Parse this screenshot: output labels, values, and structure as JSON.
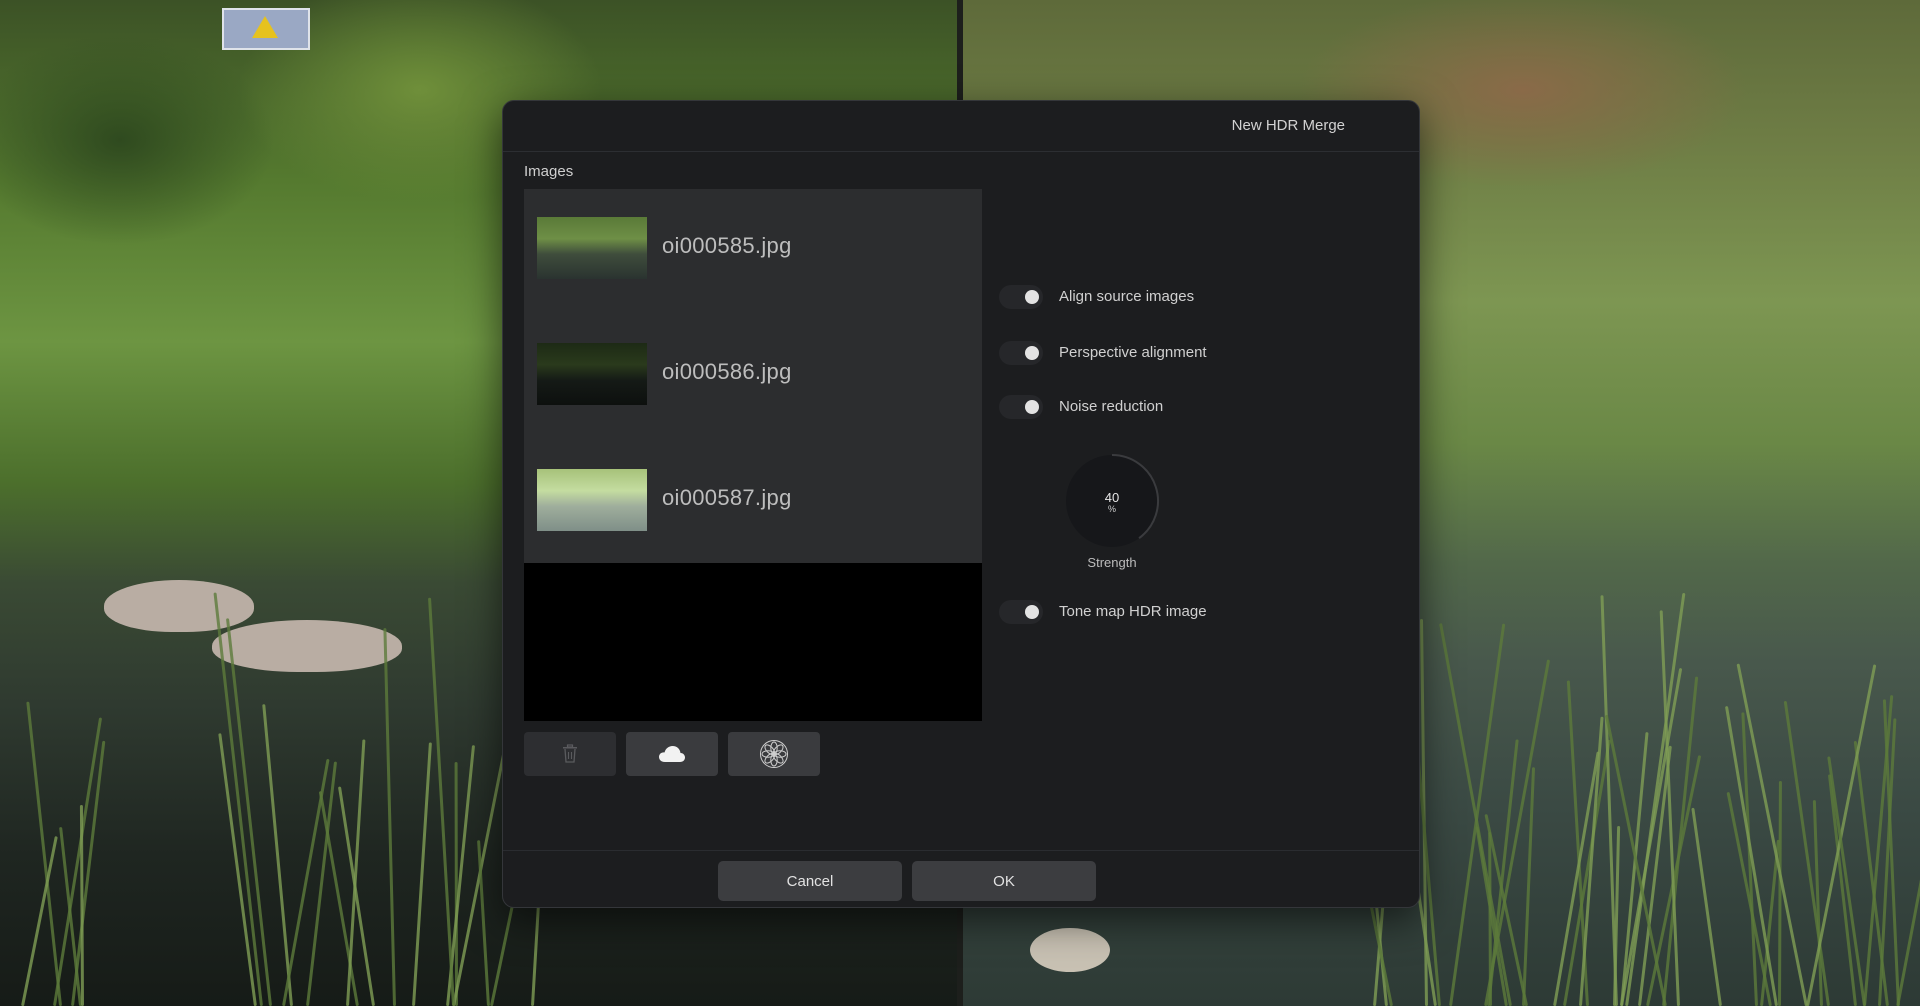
{
  "dialog": {
    "title": "New HDR Merge",
    "images_section_label": "Images",
    "images": [
      {
        "file_name": "oi000585.jpg",
        "thumb_tone": "normal"
      },
      {
        "file_name": "oi000586.jpg",
        "thumb_tone": "dark"
      },
      {
        "file_name": "oi000587.jpg",
        "thumb_tone": "bright"
      }
    ],
    "tools": [
      {
        "name": "delete",
        "icon": "trash-icon",
        "enabled": false
      },
      {
        "name": "cloud",
        "icon": "cloud-icon",
        "enabled": true
      },
      {
        "name": "photos",
        "icon": "photos-flower-icon",
        "enabled": true
      }
    ],
    "options": {
      "align": {
        "label": "Align source images",
        "on": false
      },
      "perspective": {
        "label": "Perspective alignment",
        "on": false
      },
      "noise": {
        "label": "Noise reduction",
        "on": false
      },
      "tonemap": {
        "label": "Tone map HDR image",
        "on": false
      }
    },
    "strength": {
      "value": "40",
      "unit": "%",
      "label": "Strength",
      "fraction": 0.4
    },
    "buttons": {
      "cancel": "Cancel",
      "ok": "OK"
    }
  },
  "colors": {
    "dialog_bg": "#1c1d1f",
    "list_bg": "#2c2d2f",
    "button_bg": "#3c3d40",
    "dial_arc": "#3a3b3e"
  }
}
